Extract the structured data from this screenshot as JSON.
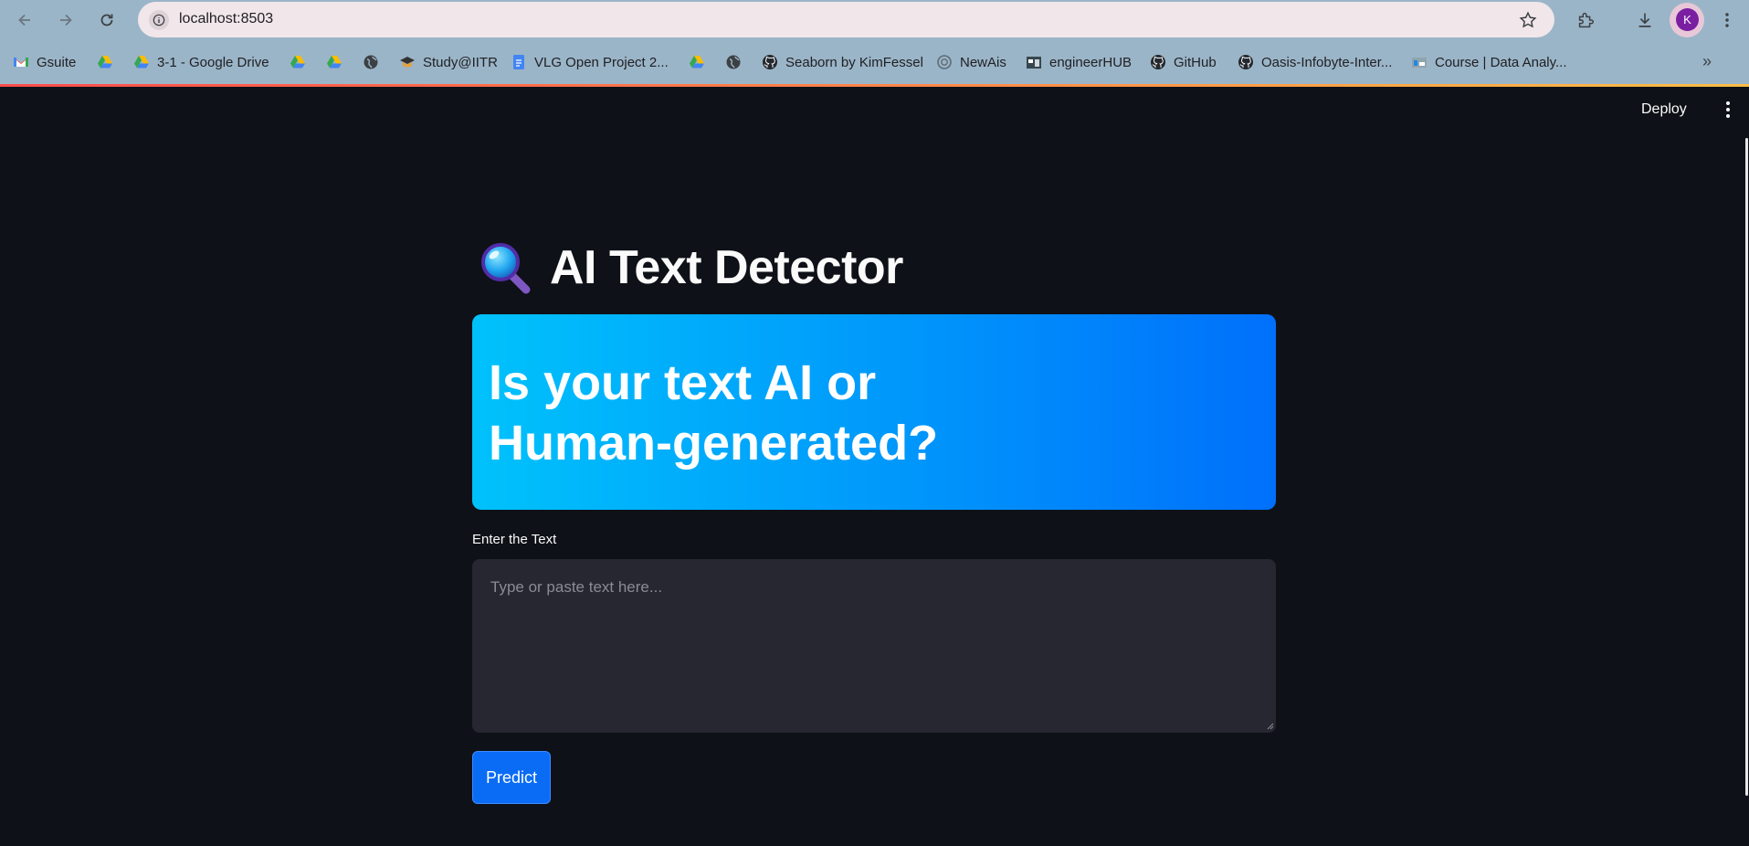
{
  "browser": {
    "url": "localhost:8503",
    "profile_initial": "K",
    "bookmarks": [
      {
        "label": "Gsuite",
        "icon": "gmail-icon"
      },
      {
        "label": "",
        "icon": "google-drive-icon"
      },
      {
        "label": "3-1 - Google Drive",
        "icon": "google-drive-icon"
      },
      {
        "label": "",
        "icon": "google-drive-icon"
      },
      {
        "label": "",
        "icon": "google-drive-icon"
      },
      {
        "label": "",
        "icon": "globe-icon"
      },
      {
        "label": "Study@IITR",
        "icon": "graduation-cap-icon"
      },
      {
        "label": "VLG Open Project 2...",
        "icon": "google-docs-icon"
      },
      {
        "label": "",
        "icon": "google-drive-icon"
      },
      {
        "label": "",
        "icon": "globe-icon"
      },
      {
        "label": "Seaborn by KimFessel",
        "icon": "github-icon"
      },
      {
        "label": "NewAis",
        "icon": "openai-icon"
      },
      {
        "label": "engineerHUB",
        "icon": "engineerhub-icon"
      },
      {
        "label": "GitHub",
        "icon": "github-icon"
      },
      {
        "label": "Oasis-Infobyte-Inter...",
        "icon": "github-icon"
      },
      {
        "label": "Course | Data Analy...",
        "icon": "course-icon"
      }
    ],
    "colors": {
      "accent_line_start": "#ff4b4b",
      "accent_line_end": "#ffbd45",
      "avatar": "#7b1fa2"
    }
  },
  "app": {
    "header": {
      "deploy_label": "Deploy"
    },
    "title": "AI Text Detector",
    "title_icon": "magnifying-glass-icon",
    "hero_text": "Is your text AI or Human-generated?",
    "input": {
      "label": "Enter the Text",
      "placeholder": "Type or paste text here...",
      "value": ""
    },
    "predict_label": "Predict",
    "colors": {
      "background": "#0e1117",
      "hero_start": "#00c2fb",
      "hero_end": "#0070fb",
      "button": "#0a6cf5",
      "input_bg": "#262730"
    }
  }
}
